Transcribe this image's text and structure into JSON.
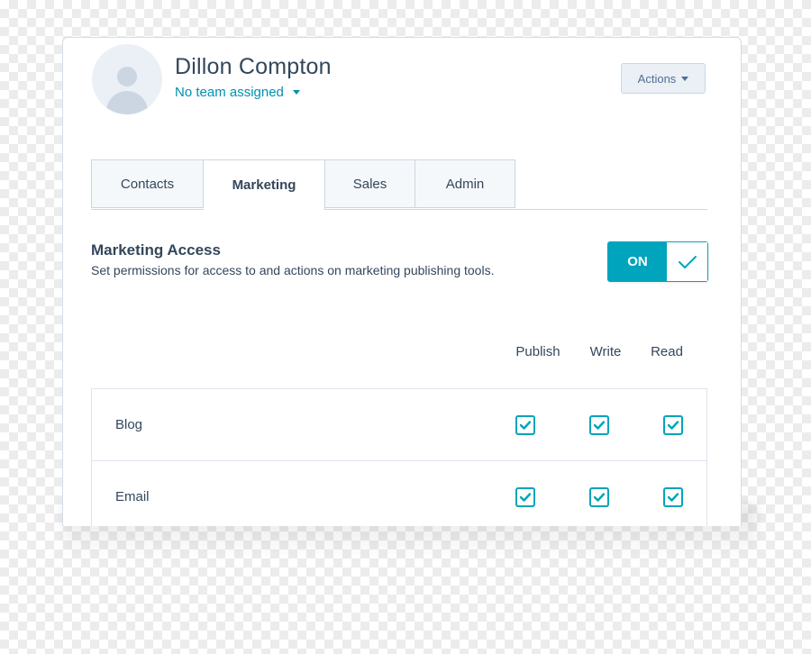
{
  "user": {
    "name": "Dillon Compton",
    "team": "No team assigned"
  },
  "header": {
    "actions_label": "Actions"
  },
  "tabs": [
    {
      "label": "Contacts",
      "active": false
    },
    {
      "label": "Marketing",
      "active": true
    },
    {
      "label": "Sales",
      "active": false
    },
    {
      "label": "Admin",
      "active": false
    }
  ],
  "access": {
    "title": "Marketing Access",
    "description": "Set permissions for access to and actions on marketing publishing tools.",
    "toggle_label": "ON",
    "enabled": true
  },
  "permissions": {
    "columns": [
      "Publish",
      "Write",
      "Read"
    ],
    "rows": [
      {
        "label": "Blog",
        "publish": true,
        "write": true,
        "read": true
      },
      {
        "label": "Email",
        "publish": true,
        "write": true,
        "read": true
      }
    ]
  },
  "colors": {
    "accent": "#00a4bd",
    "link": "#0091ae",
    "text": "#33475b"
  }
}
